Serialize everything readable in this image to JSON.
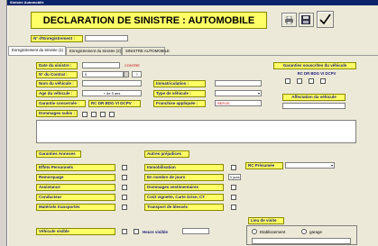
{
  "window": {
    "title": "Sinistre Automobile"
  },
  "header": {
    "title": "DECLARATION DE SINISTRE : AUTOMOBILE"
  },
  "toolbar": {
    "print_icon": "printer-icon",
    "save_icon": "save-icon",
    "check_icon": "checkmark-icon"
  },
  "registration": {
    "label": "N° d'Enregistrement :",
    "value": ""
  },
  "tabs": [
    {
      "label": "Enregistrement du Sinistre (1)"
    },
    {
      "label": "Enregistrement du Sinistre (2)"
    },
    {
      "label": "SINISTRE AUTOMOBILE"
    }
  ],
  "form": {
    "date_label": "Date du sinistre :",
    "date_value": "",
    "date_note": "CONTRE",
    "contrat_label": "N° du Contrat :",
    "contrat_value": "0",
    "contrat_small": "?",
    "vehicule_label": "Nom du véhicule :",
    "vehicule_value": "",
    "immat_label": "Immatriculation :",
    "immat_value": "",
    "age_label": "Age du véhicule :",
    "age_value": "+ de 5 ans",
    "type_label": "Type de véhicule :",
    "type_value": "",
    "garantie_label": "Garantie concernée :",
    "garantie_codes": "RC DR BDG VI DCPV",
    "franchise_label": "Franchise appliquée :",
    "franchise_value": "REFUS",
    "dommages_label": "Dommages subis :",
    "souscrites_label": "Garanties souscrites du véhicule",
    "souscrites_codes": "RC DR BDG VI DCPV",
    "affectation_label": "Affectation du véhicule"
  },
  "annexes": {
    "title": "Garanties Annexes",
    "items": [
      "Effets Personnels",
      "Remorquage",
      "Assistance",
      "Conducteur",
      "Matériels transportés"
    ]
  },
  "prejudices": {
    "title": "Autres préjudices",
    "items": [
      "Immobilisation",
      "En nombre de jours",
      "Dommages vestimentaires",
      "Coût vignette, Carte Grise, CT",
      "Transport de blessés"
    ],
    "days_value": "0 jours"
  },
  "rc_presumee": {
    "label": "RC Présumée",
    "value": ""
  },
  "bottom": {
    "visible_label": "Véhicule visible",
    "heure_label": "Heure visible",
    "heure_value": "",
    "lieu_title": "Lieu de visite",
    "etablissement": "Etablissement",
    "garage": "garage"
  }
}
